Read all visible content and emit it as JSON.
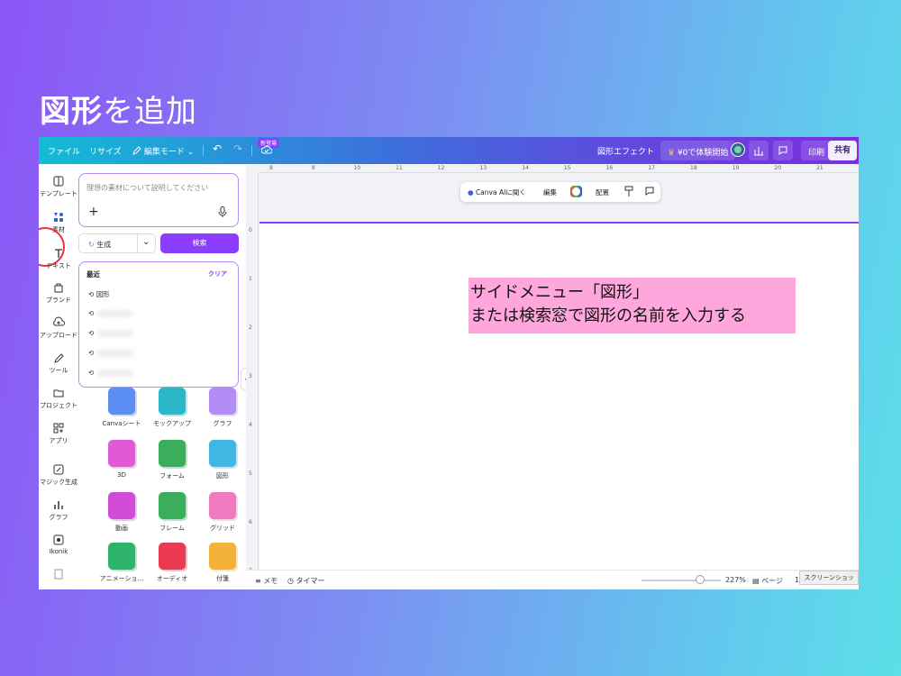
{
  "slide": {
    "title_bold": "図形",
    "title_rest": "を追加"
  },
  "topbar": {
    "file": "ファイル",
    "resize": "リサイズ",
    "edit_mode": "編集モード",
    "new_badge": "新登場",
    "shape_effect": "図形エフェクト",
    "trial": "¥0で体験開始",
    "print": "印刷",
    "share": "共有"
  },
  "rail": {
    "items": [
      {
        "label": "テンプレート",
        "icon": "template-icon"
      },
      {
        "label": "素材",
        "icon": "elements-icon"
      },
      {
        "label": "テキスト",
        "icon": "text-icon"
      },
      {
        "label": "ブランド",
        "icon": "brand-icon"
      },
      {
        "label": "アップロード",
        "icon": "upload-icon"
      },
      {
        "label": "ツール",
        "icon": "tool-icon"
      },
      {
        "label": "プロジェクト",
        "icon": "folder-icon"
      },
      {
        "label": "アプリ",
        "icon": "apps-icon"
      },
      {
        "label": "マジック生成",
        "icon": "magic-icon"
      },
      {
        "label": "グラフ",
        "icon": "chart-icon"
      },
      {
        "label": "Ikonik",
        "icon": "ikonik-icon"
      }
    ]
  },
  "panel": {
    "ai_placeholder": "理想の素材について説明してください",
    "generate": "生成",
    "search": "検索",
    "recent_header": "最近",
    "clear": "クリア",
    "recent_items": [
      "図形"
    ],
    "grid": [
      {
        "label": "Canvaシート",
        "color": "#5b8df5"
      },
      {
        "label": "モックアップ",
        "color": "#2bb7c9"
      },
      {
        "label": "グラフ",
        "color": "#b48cf5"
      },
      {
        "label": "3D",
        "color": "#e05ad8"
      },
      {
        "label": "フォーム",
        "color": "#3aae5a"
      },
      {
        "label": "図形",
        "color": "#3fb6e4"
      },
      {
        "label": "動画",
        "color": "#d24ad8"
      },
      {
        "label": "フレーム",
        "color": "#3aae5a"
      },
      {
        "label": "グリッド",
        "color": "#f07ac0"
      },
      {
        "label": "アニメーショ...",
        "color": "#2db46a"
      },
      {
        "label": "オーディオ",
        "color": "#ea3b52"
      },
      {
        "label": "付箋",
        "color": "#f5b23a"
      }
    ]
  },
  "canvas": {
    "toolbar": {
      "ai_open": "Canva AIに聞く",
      "edit": "編集",
      "arrange": "配置"
    },
    "ruler_h": [
      "8",
      "9",
      "10",
      "11",
      "12",
      "13",
      "14",
      "15",
      "16",
      "17",
      "18",
      "19",
      "20",
      "21"
    ],
    "ruler_v": [
      "0",
      "1",
      "2",
      "3",
      "4",
      "5",
      "6",
      "7"
    ],
    "callout_line1": "サイドメニュー「図形」",
    "callout_line2": "または検索窓で図形の名前を入力する"
  },
  "statusbar": {
    "memo": "メモ",
    "timer": "タイマー",
    "zoom": "227%",
    "page": "ページ",
    "page_num": "1/",
    "screenshot_tip": "スクリーンショッ"
  }
}
